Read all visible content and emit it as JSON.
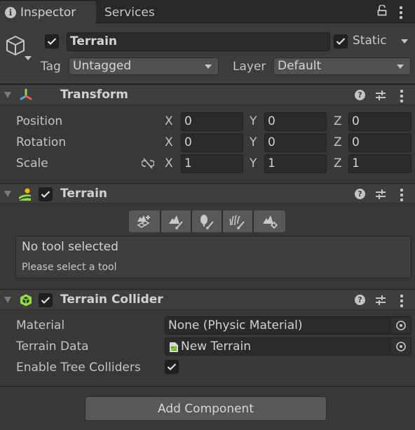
{
  "tabs": [
    {
      "label": "Inspector",
      "icon": "info-icon",
      "active": true
    },
    {
      "label": "Services",
      "active": false
    }
  ],
  "window_controls": {
    "lock": "lock-icon",
    "menu": "kebab-menu-icon"
  },
  "gameobject": {
    "active": true,
    "name": "Terrain",
    "static_checked": true,
    "static_label": "Static",
    "tag_label": "Tag",
    "tag_value": "Untagged",
    "layer_label": "Layer",
    "layer_value": "Default"
  },
  "transform": {
    "title": "Transform",
    "rows": [
      {
        "label": "Position",
        "x": "0",
        "y": "0",
        "z": "0"
      },
      {
        "label": "Rotation",
        "x": "0",
        "y": "0",
        "z": "0"
      },
      {
        "label": "Scale",
        "x": "1",
        "y": "1",
        "z": "1"
      }
    ],
    "axis_labels": [
      "X",
      "Y",
      "Z"
    ]
  },
  "terrain": {
    "title": "Terrain",
    "enabled": true,
    "tools": [
      "create-neighbor-terrains",
      "paint-terrain",
      "paint-trees",
      "paint-details",
      "terrain-settings"
    ],
    "help_title": "No tool selected",
    "help_text": "Please select a tool"
  },
  "terrain_collider": {
    "title": "Terrain Collider",
    "enabled": true,
    "material_label": "Material",
    "material_value": "None (Physic Material)",
    "terrain_data_label": "Terrain Data",
    "terrain_data_value": "New Terrain",
    "tree_colliders_label": "Enable Tree Colliders",
    "tree_colliders_checked": true
  },
  "add_component_label": "Add Component",
  "colors": {
    "background": "#383838",
    "header": "#3e3e3e",
    "field": "#2a2a2a",
    "button": "#585858",
    "transform_x": "#ef5e4b",
    "transform_y": "#8fdf42",
    "transform_z": "#4ea9e8",
    "collider_green": "#8fe23a",
    "terrain_sun": "#f2b705"
  }
}
